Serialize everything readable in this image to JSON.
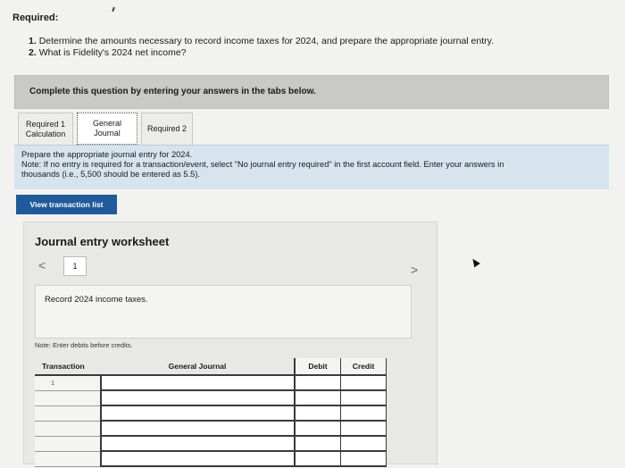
{
  "header": {
    "required_label": "Required:",
    "questions": [
      {
        "num": "1.",
        "text": "Determine the amounts necessary to record income taxes for 2024, and prepare the appropriate journal entry."
      },
      {
        "num": "2.",
        "text": "What is Fidelity's 2024 net income?"
      }
    ]
  },
  "complete_bar": {
    "text": "Complete this question by entering your answers in the tabs below."
  },
  "tabs": [
    {
      "line1": "Required 1",
      "line2": "Calculation"
    },
    {
      "line1": "General",
      "line2": "Journal"
    },
    {
      "line1": "Required 2",
      "line2": ""
    }
  ],
  "instructions": {
    "line1": "Prepare the appropriate journal entry for 2024.",
    "line2": "Note: If no entry is required for a transaction/event, select \"No journal entry required\" in the first account field. Enter your answers in",
    "line3": "thousands (i.e., 5,500 should be entered as 5.5)."
  },
  "view_button": "View transaction list",
  "worksheet": {
    "title": "Journal entry worksheet",
    "nav_left": "<",
    "nav_right": ">",
    "page": "1",
    "record_text": "Record 2024 income taxes.",
    "note": "Note: Enter debits before credits.",
    "columns": {
      "transaction": "Transaction",
      "general_journal": "General Journal",
      "debit": "Debit",
      "credit": "Credit"
    },
    "first_row_transaction": "1"
  }
}
